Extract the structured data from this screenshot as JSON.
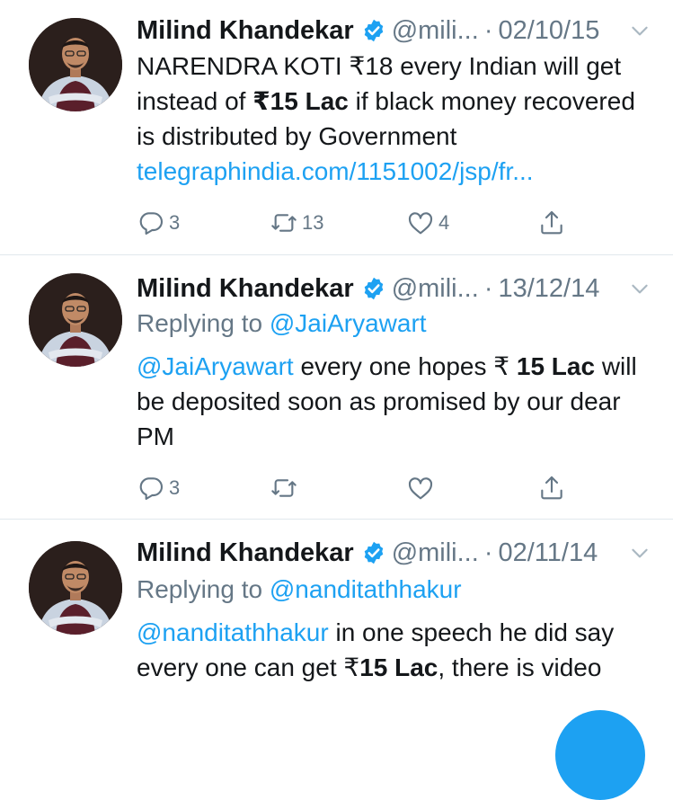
{
  "colors": {
    "accent": "#1da1f2",
    "secondary_text": "#657786",
    "primary_text": "#14171a",
    "divider": "#e1e8ed"
  },
  "tweets": [
    {
      "name": "Milind Khandekar",
      "handle": "@mili...",
      "date": "02/10/15",
      "text_parts": [
        {
          "t": "NARENDRA KOTI ₹18 every Indian will get instead of "
        },
        {
          "b": "₹15 Lac"
        },
        {
          "t": " if black money recovered is distributed by Government "
        },
        {
          "link": "telegraphindia.com/1151002/jsp/fr..."
        }
      ],
      "reply_count": "3",
      "retweet_count": "13",
      "like_count": "4"
    },
    {
      "name": "Milind Khandekar",
      "handle": "@mili...",
      "date": "13/12/14",
      "replying_to_label": "Replying to ",
      "replying_to_handle": "@JaiAryawart",
      "text_parts": [
        {
          "link": "@JaiAryawart"
        },
        {
          "t": " every one hopes ₹ "
        },
        {
          "b": "15 Lac"
        },
        {
          "t": " will be deposited soon as promised by our dear PM"
        }
      ],
      "reply_count": "3",
      "retweet_count": "",
      "like_count": ""
    },
    {
      "name": "Milind Khandekar",
      "handle": "@mili...",
      "date": "02/11/14",
      "replying_to_label": "Replying to ",
      "replying_to_handle": "@nanditathhakur",
      "text_parts": [
        {
          "link": "@nanditathhakur"
        },
        {
          "t": " in one speech he did say every one can get ₹"
        },
        {
          "b": "15 Lac"
        },
        {
          "t": ", there is video"
        }
      ]
    }
  ],
  "icons": {
    "verified": "verified-badge-icon",
    "caret": "chevron-down-icon",
    "reply": "reply-icon",
    "retweet": "retweet-icon",
    "like": "heart-icon",
    "share": "share-icon"
  }
}
